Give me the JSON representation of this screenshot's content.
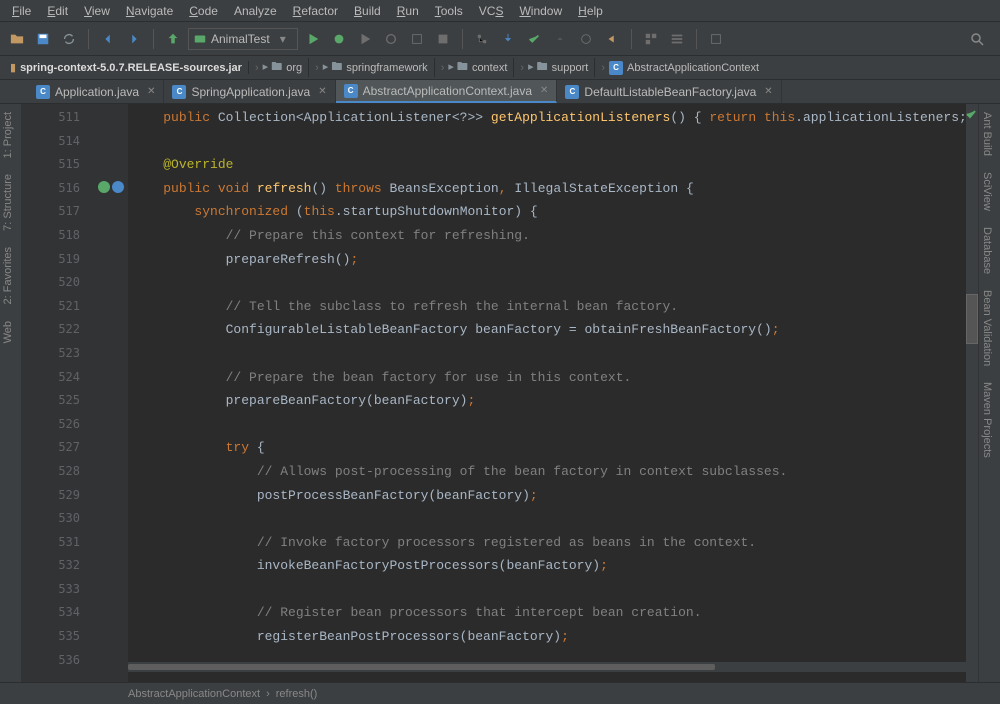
{
  "menu": [
    "File",
    "Edit",
    "View",
    "Navigate",
    "Code",
    "Analyze",
    "Refactor",
    "Build",
    "Run",
    "Tools",
    "VCS",
    "Window",
    "Help"
  ],
  "menu_underlines": [
    "F",
    "E",
    "V",
    "N",
    "C",
    "",
    "R",
    "B",
    "R",
    "T",
    "S",
    "W",
    "H"
  ],
  "run_config": "AnimalTest",
  "breadcrumbs": [
    {
      "icon": "jar",
      "label": "spring-context-5.0.7.RELEASE-sources.jar"
    },
    {
      "icon": "folder",
      "label": "org"
    },
    {
      "icon": "folder",
      "label": "springframework"
    },
    {
      "icon": "folder",
      "label": "context"
    },
    {
      "icon": "folder",
      "label": "support"
    },
    {
      "icon": "class",
      "label": "AbstractApplicationContext"
    }
  ],
  "tabs": [
    {
      "icon": "class",
      "label": "Application.java",
      "active": false,
      "close": true
    },
    {
      "icon": "class",
      "label": "SpringApplication.java",
      "active": false,
      "close": true
    },
    {
      "icon": "class",
      "label": "AbstractApplicationContext.java",
      "active": true,
      "close": true
    },
    {
      "icon": "class",
      "label": "DefaultListableBeanFactory.java",
      "active": false,
      "close": true
    }
  ],
  "line_start": 511,
  "code_lines": [
    {
      "n": 511,
      "html": "    <span class='kw'>public</span> Collection&lt;ApplicationListener&lt;?&gt;&gt; <span class='fn'>getApplicationListeners</span>() { <span class='kw'>return this</span>.applicationListeners; }"
    },
    {
      "n": 514,
      "html": ""
    },
    {
      "n": 515,
      "html": "    <span class='ann'>@Override</span>"
    },
    {
      "n": 516,
      "html": "    <span class='kw'>public void</span> <span class='fn'>refresh</span>() <span class='kw'>throws</span> BeansException<span class='punct'>,</span> IllegalStateException {",
      "marker": true
    },
    {
      "n": 517,
      "html": "        <span class='kw'>synchronized</span> (<span class='kw'>this</span>.startupShutdownMonitor) {"
    },
    {
      "n": 518,
      "html": "            <span class='cm'>// Prepare this context for refreshing.</span>"
    },
    {
      "n": 519,
      "html": "            prepareRefresh()<span class='punct'>;</span>"
    },
    {
      "n": 520,
      "html": ""
    },
    {
      "n": 521,
      "html": "            <span class='cm'>// Tell the subclass to refresh the internal bean factory.</span>"
    },
    {
      "n": 522,
      "html": "            ConfigurableListableBeanFactory beanFactory = obtainFreshBeanFactory()<span class='punct'>;</span>"
    },
    {
      "n": 523,
      "html": ""
    },
    {
      "n": 524,
      "html": "            <span class='cm'>// Prepare the bean factory for use in this context.</span>"
    },
    {
      "n": 525,
      "html": "            prepareBeanFactory(beanFactory)<span class='punct'>;</span>"
    },
    {
      "n": 526,
      "html": ""
    },
    {
      "n": 527,
      "html": "            <span class='kw'>try</span> {"
    },
    {
      "n": 528,
      "html": "                <span class='cm'>// Allows post-processing of the bean factory in context subclasses.</span>"
    },
    {
      "n": 529,
      "html": "                postProcessBeanFactory(beanFactory)<span class='punct'>;</span>"
    },
    {
      "n": 530,
      "html": ""
    },
    {
      "n": 531,
      "html": "                <span class='cm'>// Invoke factory processors registered as beans in the context.</span>"
    },
    {
      "n": 532,
      "html": "                invokeBeanFactoryPostProcessors(beanFactory)<span class='punct'>;</span>"
    },
    {
      "n": 533,
      "html": ""
    },
    {
      "n": 534,
      "html": "                <span class='cm'>// Register bean processors that intercept bean creation.</span>"
    },
    {
      "n": 535,
      "html": "                registerBeanPostProcessors(beanFactory)<span class='punct'>;</span>"
    },
    {
      "n": 536,
      "html": ""
    }
  ],
  "left_tools": [
    "1: Project",
    "7: Structure",
    "2: Favorites",
    "Web"
  ],
  "right_tools": [
    "Ant Build",
    "SciView",
    "Database",
    "Bean Validation",
    "Maven Projects"
  ],
  "bottom_crumb": [
    "AbstractApplicationContext",
    "refresh()"
  ]
}
